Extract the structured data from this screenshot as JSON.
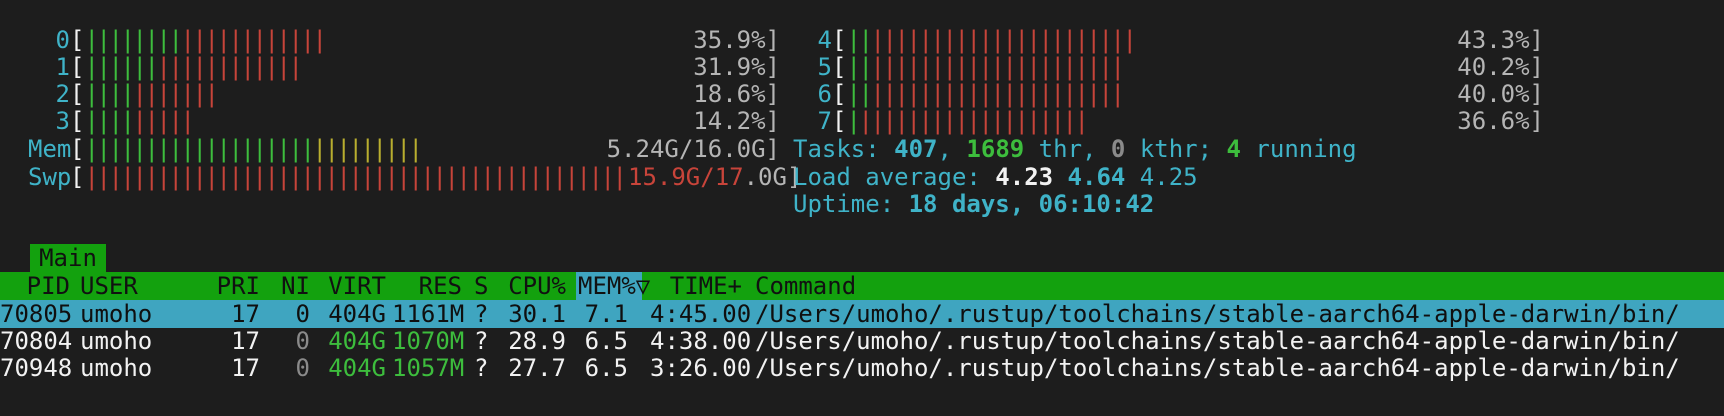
{
  "meters_left": [
    {
      "label": "0",
      "green": 8,
      "red": 12,
      "yellow": 0,
      "value": "35.9%]"
    },
    {
      "label": "1",
      "green": 6,
      "red": 12,
      "yellow": 0,
      "value": "31.9%]"
    },
    {
      "label": "2",
      "green": 4,
      "red": 7,
      "yellow": 0,
      "value": "18.6%]"
    },
    {
      "label": "3",
      "green": 4,
      "red": 5,
      "yellow": 0,
      "value": "14.2%]"
    },
    {
      "label": "Mem",
      "green": 19,
      "red": 0,
      "yellow": 9,
      "value": "5.24G/16.0G]"
    }
  ],
  "swap": {
    "label": "Swp",
    "red": 45,
    "value_red": "15.9G/17",
    "value_rest": ".0G]"
  },
  "meters_right": [
    {
      "label": "4",
      "green": 2,
      "red": 22,
      "yellow": 0,
      "value": "43.3%]"
    },
    {
      "label": "5",
      "green": 2,
      "red": 21,
      "yellow": 0,
      "value": "40.2%]"
    },
    {
      "label": "6",
      "green": 2,
      "red": 21,
      "yellow": 0,
      "value": "40.0%]"
    },
    {
      "label": "7",
      "green": 1,
      "red": 19,
      "yellow": 0,
      "value": "36.6%]"
    }
  ],
  "tasks": {
    "label": "Tasks: ",
    "count": "407",
    "sep1": ", ",
    "threads": "1689",
    "thr_label": " thr, ",
    "kthr": "0",
    "kthr_label": " kthr; ",
    "running": "4",
    "running_label": " running"
  },
  "load": {
    "label": "Load average: ",
    "l1": "4.23",
    "l5": "4.64",
    "l15": "4.25"
  },
  "uptime": {
    "label": "Uptime: ",
    "value": "18 days, 06:10:42"
  },
  "tab_label": "Main",
  "columns": {
    "pid": "PID",
    "user": "USER",
    "pri": "PRI",
    "ni": "NI",
    "virt": "VIRT",
    "res": "RES",
    "s": "S",
    "cpu": "CPU%",
    "mem": "MEM%▽",
    "time": "TIME+",
    "command": "Command"
  },
  "processes": [
    {
      "pid": "70805",
      "user": "umoho",
      "pri": "17",
      "ni": "0",
      "virt": "404G",
      "res": "1161M",
      "s": "?",
      "cpu": "30.1",
      "mem": "7.1",
      "time": "4:45.00",
      "command": "/Users/umoho/.rustup/toolchains/stable-aarch64-apple-darwin/bin/"
    },
    {
      "pid": "70804",
      "user": "umoho",
      "pri": "17",
      "ni": "0",
      "virt": "404G",
      "res": "1070M",
      "s": "?",
      "cpu": "28.9",
      "mem": "6.5",
      "time": "4:38.00",
      "command": "/Users/umoho/.rustup/toolchains/stable-aarch64-apple-darwin/bin/"
    },
    {
      "pid": "70948",
      "user": "umoho",
      "pri": "17",
      "ni": "0",
      "virt": "404G",
      "res": "1057M",
      "s": "?",
      "cpu": "27.7",
      "mem": "6.5",
      "time": "3:26.00",
      "command": "/Users/umoho/.rustup/toolchains/stable-aarch64-apple-darwin/bin/"
    }
  ],
  "colors": {
    "header_green": "#13a10e",
    "selected_cyan": "#3fa5c0",
    "bar_green": "#3dbd3d",
    "bar_red": "#c8443a",
    "bar_yellow": "#b9ae2f",
    "label_cyan": "#3fb3c8"
  }
}
